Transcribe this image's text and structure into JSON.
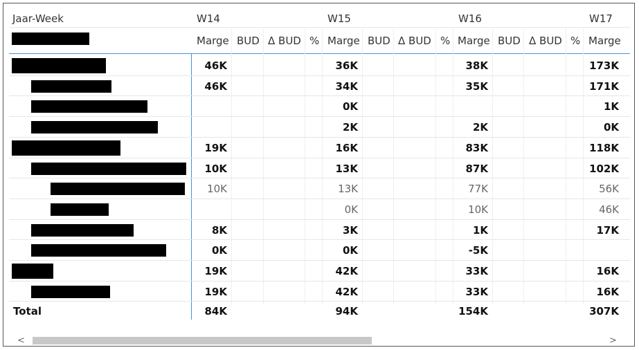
{
  "table": {
    "corner_label": "Jaar-Week",
    "weeks": [
      "W14",
      "W15",
      "W16",
      "W17"
    ],
    "sub_headers": {
      "marge": "Marge",
      "bud": "BUD",
      "delta_bud": "Δ BUD",
      "pct": "%"
    },
    "rows": [
      {
        "level": 0,
        "style": "bold",
        "values": [
          "46K",
          "36K",
          "38K",
          "173K"
        ]
      },
      {
        "level": 1,
        "style": "bold",
        "values": [
          "46K",
          "34K",
          "35K",
          "171K"
        ]
      },
      {
        "level": 1,
        "style": "bold",
        "values": [
          "",
          "0K",
          "",
          "1K"
        ]
      },
      {
        "level": 1,
        "style": "bold",
        "values": [
          "",
          "2K",
          "2K",
          "0K"
        ]
      },
      {
        "level": 0,
        "style": "bold",
        "values": [
          "19K",
          "16K",
          "83K",
          "118K"
        ]
      },
      {
        "level": 1,
        "style": "bold",
        "values": [
          "10K",
          "13K",
          "87K",
          "102K"
        ]
      },
      {
        "level": 2,
        "style": "light",
        "values": [
          "10K",
          "13K",
          "77K",
          "56K"
        ]
      },
      {
        "level": 2,
        "style": "light",
        "values": [
          "",
          "0K",
          "10K",
          "46K"
        ]
      },
      {
        "level": 1,
        "style": "bold",
        "values": [
          "8K",
          "3K",
          "1K",
          "17K"
        ]
      },
      {
        "level": 1,
        "style": "bold",
        "values": [
          "0K",
          "0K",
          "-5K",
          ""
        ]
      },
      {
        "level": 0,
        "style": "bold",
        "values": [
          "19K",
          "42K",
          "33K",
          "16K"
        ]
      },
      {
        "level": 1,
        "style": "bold",
        "values": [
          "19K",
          "42K",
          "33K",
          "16K"
        ]
      }
    ],
    "total": {
      "label": "Total",
      "values": [
        "84K",
        "94K",
        "154K",
        "307K"
      ]
    }
  },
  "scrollbar": {
    "left_arrow": "<",
    "right_arrow": ">"
  }
}
